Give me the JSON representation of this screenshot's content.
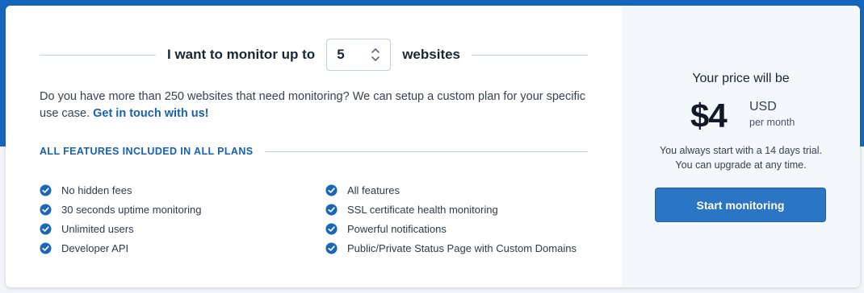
{
  "monitor": {
    "prefix": "I want to monitor up to",
    "value": "5",
    "suffix": "websites"
  },
  "info": {
    "text": "Do you have more than 250 websites that need monitoring? We can setup a custom plan for your specific use case.",
    "link": "Get in touch with us!"
  },
  "features": {
    "title": "ALL FEATURES INCLUDED IN ALL PLANS",
    "left": [
      "No hidden fees",
      "30 seconds uptime monitoring",
      "Unlimited users",
      "Developer API"
    ],
    "right": [
      "All features",
      "SSL certificate health monitoring",
      "Powerful notifications",
      "Public/Private Status Page with Custom Domains"
    ]
  },
  "pricing": {
    "title": "Your price will be",
    "amount": "$4",
    "currency": "USD",
    "period": "per month",
    "trial_line1": "You always start with a 14 days trial.",
    "trial_line2": "You can upgrade at any time.",
    "cta": "Start monitoring"
  },
  "colors": {
    "brand_blue": "#1766be",
    "link_blue": "#1860b0",
    "button_blue": "#2a75c4",
    "check_blue": "#1a67b8"
  },
  "icons": {
    "check": "check-circle-icon",
    "stepper": "chevron-up-down-icon"
  }
}
